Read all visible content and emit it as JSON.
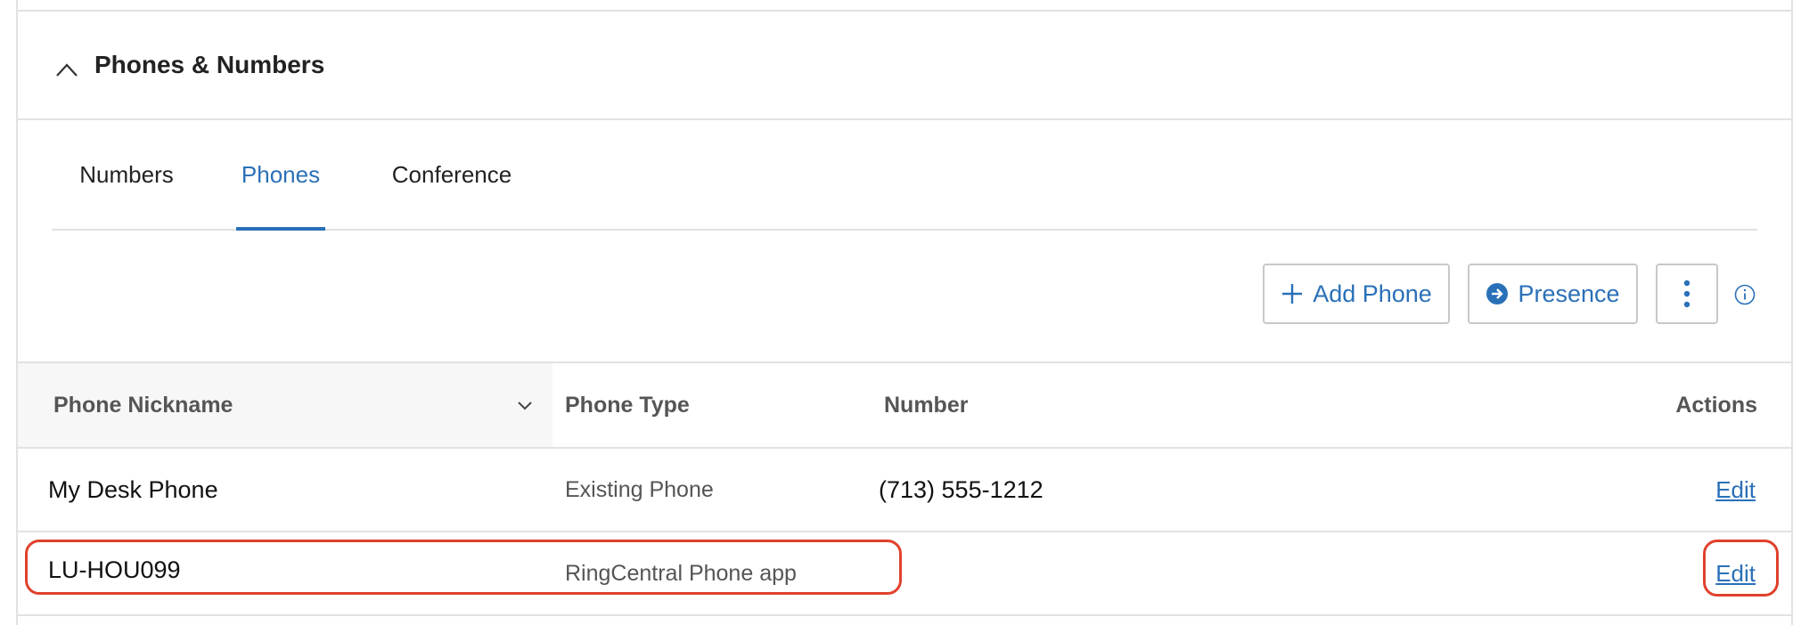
{
  "section": {
    "title": "Phones & Numbers",
    "collapse_icon": "chevron-up-icon"
  },
  "tabs": [
    {
      "label": "Numbers",
      "active": false
    },
    {
      "label": "Phones",
      "active": true
    },
    {
      "label": "Conference",
      "active": false
    }
  ],
  "toolbar": {
    "add_phone_label": "Add Phone",
    "add_phone_icon": "plus-icon",
    "presence_label": "Presence",
    "presence_icon": "arrow-circle-right-icon",
    "more_icon": "vertical-ellipsis-icon",
    "info_icon": "info-icon"
  },
  "table": {
    "columns": {
      "nickname": "Phone Nickname",
      "type": "Phone Type",
      "number": "Number",
      "actions": "Actions"
    },
    "sort_icon": "chevron-down-icon",
    "rows": [
      {
        "nickname": "My Desk Phone",
        "type": "Existing Phone",
        "number": "(713) 555-1212",
        "action": "Edit"
      },
      {
        "nickname": "LU-HOU099",
        "type": "RingCentral Phone app",
        "number": "",
        "action": "Edit"
      }
    ]
  },
  "colors": {
    "accent": "#2a70b8",
    "highlight": "#e0412c",
    "divider": "#e2e2e2"
  }
}
